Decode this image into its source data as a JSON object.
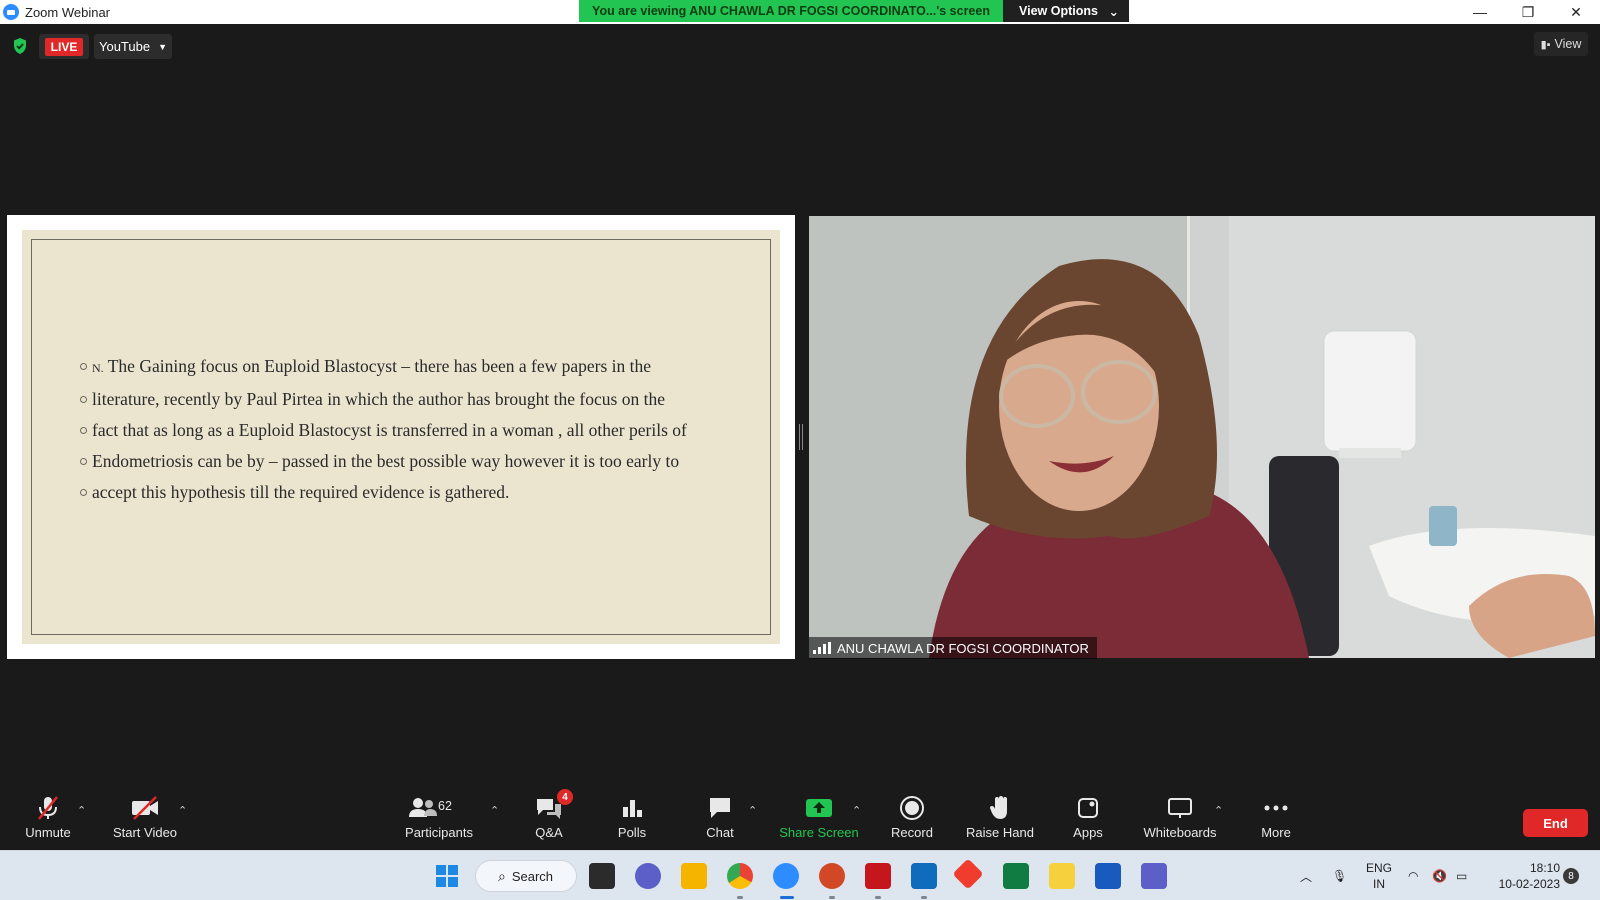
{
  "window": {
    "title": "Zoom Webinar",
    "share_banner": "You are viewing ANU CHAWLA DR FOGSI COORDINATO...'s screen",
    "view_options": "View Options"
  },
  "webinar": {
    "live_label": "LIVE",
    "stream_target": "YouTube",
    "view_label": "View"
  },
  "slide": {
    "bullets": [
      {
        "prefix": "N.",
        "text": " The Gaining focus on Euploid Blastocyst – there has been a few papers in the"
      },
      {
        "prefix": "",
        "text": "literature, recently by Paul Pirtea in which the author has brought the focus on the"
      },
      {
        "prefix": "",
        "text": "fact that as long as a Euploid Blastocyst is transferred in a woman , all other perils of"
      },
      {
        "prefix": "",
        "text": "Endometriosis can be by – passed in the best possible way however it is too early to"
      },
      {
        "prefix": "",
        "text": "accept this hypothesis till the required evidence is gathered."
      }
    ]
  },
  "video": {
    "participant_name": "ANU CHAWLA DR FOGSI COORDINATOR"
  },
  "toolbar": {
    "unmute": "Unmute",
    "start_video": "Start Video",
    "participants": "Participants",
    "participants_count": "62",
    "qa": "Q&A",
    "qa_badge": "4",
    "polls": "Polls",
    "chat": "Chat",
    "share_screen": "Share Screen",
    "record": "Record",
    "raise_hand": "Raise Hand",
    "apps": "Apps",
    "whiteboards": "Whiteboards",
    "more": "More",
    "end": "End"
  },
  "taskbar": {
    "search_label": "Search",
    "language_top": "ENG",
    "language_bottom": "IN",
    "time": "18:10",
    "date": "10-02-2023",
    "notification_count": "8"
  }
}
